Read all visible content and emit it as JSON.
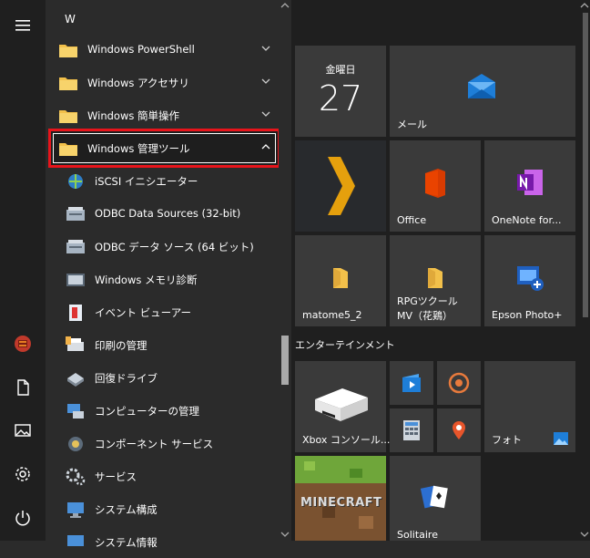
{
  "list": {
    "letter": "W",
    "items": [
      {
        "label": "Windows PowerShell",
        "icon": "folder-icon"
      },
      {
        "label": "Windows アクセサリ",
        "icon": "folder-icon"
      },
      {
        "label": "Windows 簡単操作",
        "icon": "folder-icon"
      },
      {
        "label": "Windows 管理ツール",
        "icon": "folder-icon"
      },
      {
        "label": "iSCSI イニシエーター",
        "icon": "iscsi-icon"
      },
      {
        "label": "ODBC Data Sources (32-bit)",
        "icon": "odbc-icon"
      },
      {
        "label": "ODBC データ ソース (64 ビット)",
        "icon": "odbc-icon"
      },
      {
        "label": "Windows メモリ診断",
        "icon": "memory-diagnostic-icon"
      },
      {
        "label": "イベント ビューアー",
        "icon": "event-viewer-icon"
      },
      {
        "label": "印刷の管理",
        "icon": "print-management-icon"
      },
      {
        "label": "回復ドライブ",
        "icon": "recovery-drive-icon"
      },
      {
        "label": "コンピューターの管理",
        "icon": "computer-management-icon"
      },
      {
        "label": "コンポーネント サービス",
        "icon": "component-services-icon"
      },
      {
        "label": "サービス",
        "icon": "services-icon"
      },
      {
        "label": "システム構成",
        "icon": "system-config-icon"
      },
      {
        "label": "システム情報",
        "icon": "system-info-icon"
      }
    ]
  },
  "tiles": {
    "calendar_day": "金曜日",
    "calendar_date": "27",
    "mail": "メール",
    "office": "Office",
    "onenote": "OneNote for...",
    "matome": "matome5_2",
    "rpg_line1": "RPGツクール",
    "rpg_line2": "MV（花鶏）",
    "epson": "Epson Photo+",
    "section": "エンターテインメント",
    "xbox": "Xbox コンソール...",
    "photos": "フォト",
    "solitaire": "Solitaire",
    "minecraft_text": "MINECRAFT"
  },
  "colors": {
    "highlight_border": "#e8141b",
    "mail_blue": "#1e7ed8",
    "plex_orange": "#e5a00d",
    "office_red": "#d83b01",
    "onenote_purple": "#7719aa"
  }
}
